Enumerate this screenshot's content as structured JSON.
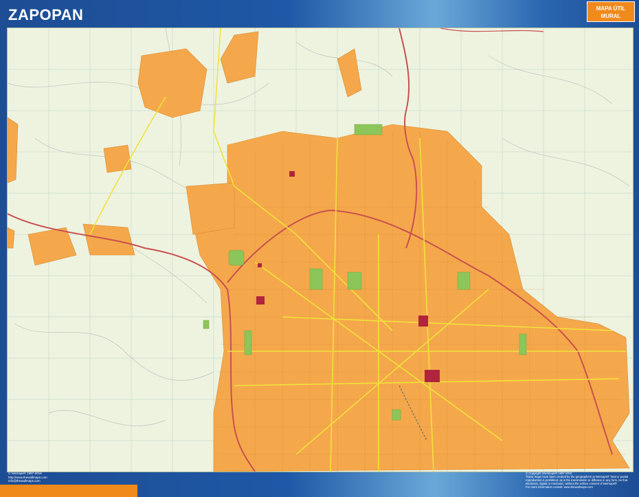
{
  "header": {
    "title": "ZAPOPAN",
    "badge_line1": "MAPA ÚTIL",
    "badge_line2": "MURAL"
  },
  "footer": {
    "left_lines": [
      "© Netmaps® 1997-2019",
      "http://www.thewallmaps.com",
      "info@thewallmaps.com"
    ],
    "right_lines": [
      "© Copyright ©Netmaps® 1997-2019",
      "These maps have been created by the geographers at Netmaps® Total or partial",
      "reproduction is prohibited, as is the transmission or diffusion in any form, be that",
      "electronic, digital or mechanic, without the written consent of Netmaps®",
      "For more information consult: www.thewallmaps.com"
    ]
  },
  "colors": {
    "frame": "#1d4d94",
    "map_background": "#eef3e0",
    "urban_area": "#f4a84b",
    "urban_dense": "#e8963a",
    "highway": "#d05a5a",
    "main_road": "#f2e23a",
    "park": "#8cc65a",
    "landmark": "#b0243c",
    "badge": "#f08a1c"
  }
}
